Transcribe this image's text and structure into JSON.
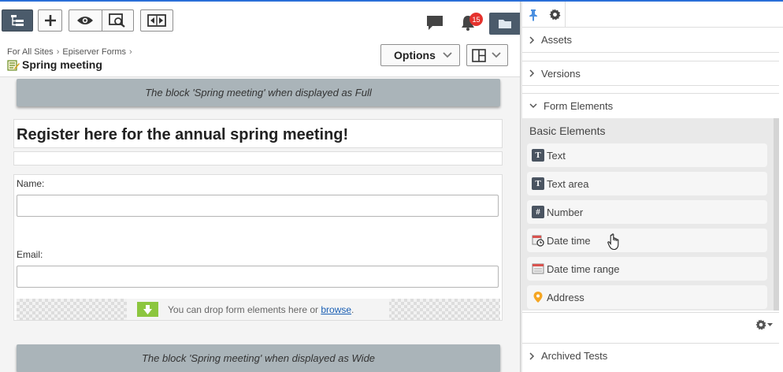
{
  "toolbar": {
    "tree_icon": "site-tree-icon",
    "add_icon": "plus-icon",
    "view_icon": "eye-icon",
    "preview_icon": "preview-search-icon",
    "compare_icon": "compare-arrows-icon",
    "notifications_count": "15",
    "options_label": "Options"
  },
  "breadcrumb": {
    "items": [
      "For All Sites",
      "Episerver Forms"
    ]
  },
  "page": {
    "title": "Spring meeting"
  },
  "canvas": {
    "block_full_label": "The block 'Spring meeting' when displayed as Full",
    "block_wide_label": "The block 'Spring meeting' when displayed as Wide",
    "heading": "Register here for the annual spring meeting!",
    "fields": {
      "name_label": "Name:",
      "email_label": "Email:"
    },
    "drop_zone": {
      "text": "You can drop form elements here or ",
      "link": "browse",
      "suffix": "."
    }
  },
  "right_panel": {
    "sections": {
      "assets": "Assets",
      "versions": "Versions",
      "form_elements": "Form Elements",
      "archived_tests": "Archived Tests"
    },
    "basic_elements_title": "Basic Elements",
    "elements": [
      {
        "label": "Text",
        "icon": "text-icon"
      },
      {
        "label": "Text area",
        "icon": "textarea-icon"
      },
      {
        "label": "Number",
        "icon": "hash-icon"
      },
      {
        "label": "Date time",
        "icon": "calendar-clock-icon"
      },
      {
        "label": "Date time range",
        "icon": "calendar-range-icon"
      },
      {
        "label": "Address",
        "icon": "map-pin-icon"
      }
    ]
  },
  "colors": {
    "accent_dark": "#4b5b6b",
    "block_header": "#aab4b9",
    "badge": "#e5322d",
    "drop_arrow": "#8cc63f",
    "address_pin": "#f5a623"
  }
}
